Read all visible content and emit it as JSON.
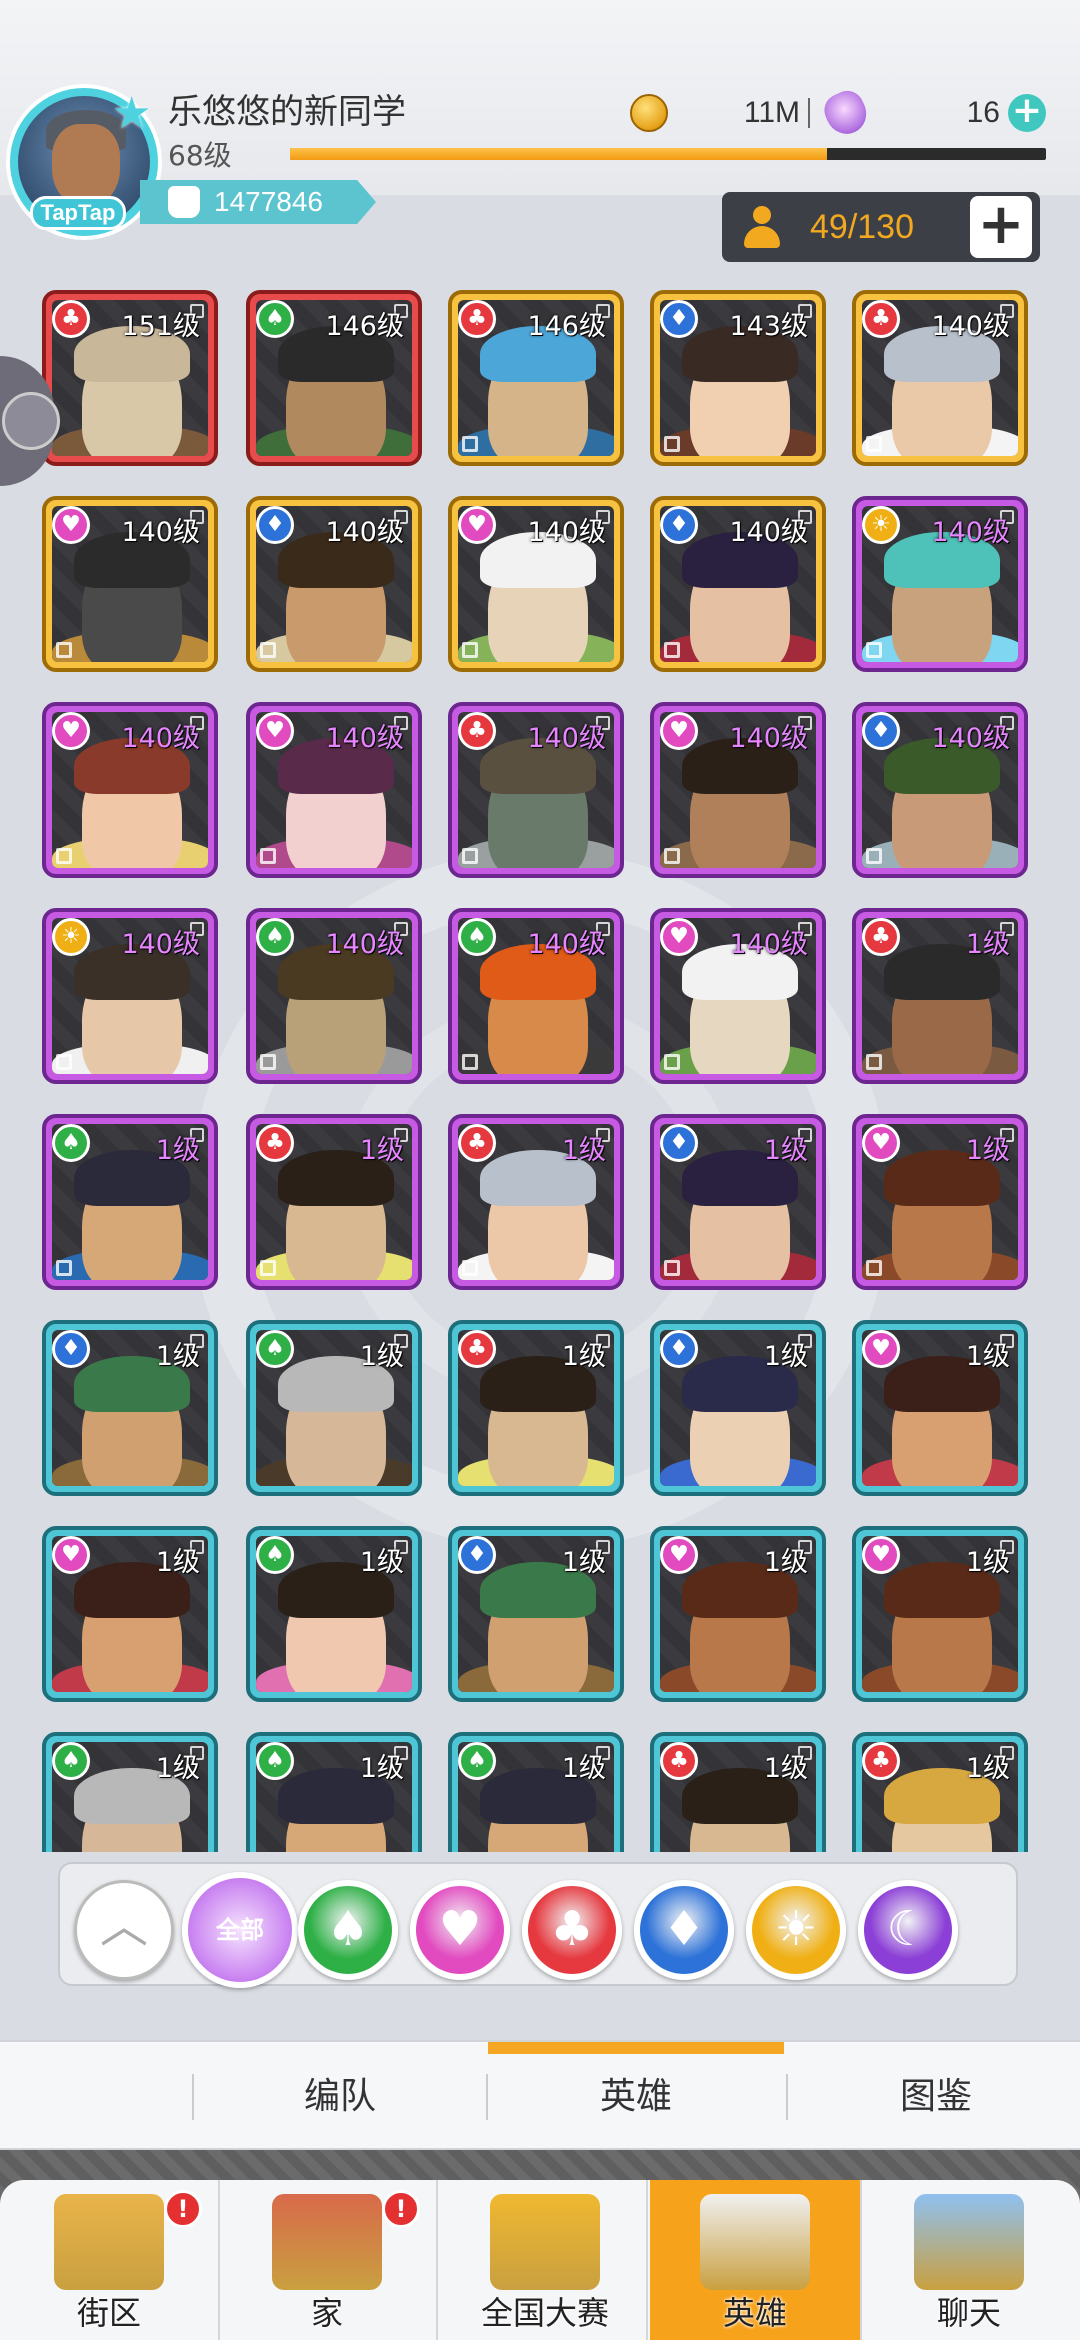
{
  "player": {
    "name": "乐悠悠的新同学",
    "level": "68级",
    "power": "1477846",
    "avatar_badge": "TapTap",
    "exp_progress": 0.71
  },
  "currency": {
    "coins": "11M",
    "gems": "16",
    "coin_icon": "gold-coin-icon",
    "gem_icon": "crystal-icon"
  },
  "capacity": {
    "text": "49/130",
    "add_label": "+"
  },
  "heroes": [
    {
      "level": "151级",
      "rarity": "red",
      "faction": "club",
      "colors": [
        "#d9c8a8",
        "#c9b79a",
        "#7a5a3a"
      ]
    },
    {
      "level": "146级",
      "rarity": "red",
      "faction": "spade",
      "colors": [
        "#b08a5e",
        "#2a2a2a",
        "#3f6e3a"
      ]
    },
    {
      "level": "146级",
      "rarity": "gold",
      "faction": "club",
      "colors": [
        "#d6b48a",
        "#4da6d8",
        "#2e6ea0"
      ]
    },
    {
      "level": "143级",
      "rarity": "gold",
      "faction": "diamond",
      "colors": [
        "#f1cfb1",
        "#3a2a24",
        "#6b3b2a"
      ]
    },
    {
      "level": "140级",
      "rarity": "gold",
      "faction": "club",
      "colors": [
        "#e9c9a8",
        "#b8c0cc",
        "#f4f4f4"
      ]
    },
    {
      "level": "140级",
      "rarity": "gold",
      "faction": "heart",
      "colors": [
        "#4a4a4a",
        "#2b2b2b",
        "#b88a3a"
      ]
    },
    {
      "level": "140级",
      "rarity": "gold",
      "faction": "diamond",
      "colors": [
        "#c99a6c",
        "#3a2a1a",
        "#d6c9a0"
      ]
    },
    {
      "level": "140级",
      "rarity": "gold",
      "faction": "heart",
      "colors": [
        "#e6d3b8",
        "#f2f2f2",
        "#86b35a"
      ]
    },
    {
      "level": "140级",
      "rarity": "gold",
      "faction": "diamond",
      "colors": [
        "#e5c0a2",
        "#2a2040",
        "#a32a3a"
      ]
    },
    {
      "level": "140级",
      "rarity": "purple",
      "faction": "sun",
      "colors": [
        "#c8a27c",
        "#4ec2b8",
        "#7ed6f0"
      ]
    },
    {
      "level": "140级",
      "rarity": "purple",
      "faction": "heart",
      "colors": [
        "#f0c8a8",
        "#8a3a2a",
        "#e8d070"
      ]
    },
    {
      "level": "140级",
      "rarity": "purple",
      "faction": "heart",
      "colors": [
        "#f3d0d0",
        "#5a2a4a",
        "#b04a8a"
      ]
    },
    {
      "level": "140级",
      "rarity": "purple",
      "faction": "club",
      "colors": [
        "#6a7a6a",
        "#5a5040",
        "#9aa0a0"
      ]
    },
    {
      "level": "140级",
      "rarity": "purple",
      "faction": "heart",
      "colors": [
        "#b0805a",
        "#2a2018",
        "#8a6a4a"
      ]
    },
    {
      "level": "140级",
      "rarity": "purple",
      "faction": "diamond",
      "colors": [
        "#c89a78",
        "#3a5a2a",
        "#9ab0b8"
      ]
    },
    {
      "level": "140级",
      "rarity": "purple",
      "faction": "sun",
      "colors": [
        "#e6c8a8",
        "#3a3028",
        "#f0f0f0"
      ]
    },
    {
      "level": "140级",
      "rarity": "purple",
      "faction": "spade",
      "colors": [
        "#b8a078",
        "#4a3a22",
        "#9a9a9a"
      ]
    },
    {
      "level": "140级",
      "rarity": "purple",
      "faction": "spade",
      "colors": [
        "#d88a4a",
        "#e05a18",
        "#3a3a3a"
      ]
    },
    {
      "level": "140级",
      "rarity": "purple",
      "faction": "heart",
      "colors": [
        "#e6d8c0",
        "#f2f2f2",
        "#6aa04a"
      ]
    },
    {
      "level": "1级",
      "rarity": "purple",
      "faction": "club",
      "colors": [
        "#9a6a48",
        "#2a2a2a",
        "#7a5a40"
      ]
    },
    {
      "level": "1级",
      "rarity": "purple",
      "faction": "spade",
      "colors": [
        "#d6a878",
        "#2a2a3a",
        "#2a6ab0"
      ]
    },
    {
      "level": "1级",
      "rarity": "purple",
      "faction": "club",
      "colors": [
        "#d8b890",
        "#2a2018",
        "#e6e070"
      ]
    },
    {
      "level": "1级",
      "rarity": "purple",
      "faction": "club",
      "colors": [
        "#ecc8a8",
        "#b8c0cc",
        "#f4f4f4"
      ]
    },
    {
      "level": "1级",
      "rarity": "purple",
      "faction": "diamond",
      "colors": [
        "#e5c0a2",
        "#2a2040",
        "#a32a3a"
      ]
    },
    {
      "level": "1级",
      "rarity": "purple",
      "faction": "heart",
      "colors": [
        "#b8784a",
        "#5a2a18",
        "#8a4a2a"
      ]
    },
    {
      "level": "1级",
      "rarity": "teal",
      "faction": "diamond",
      "colors": [
        "#d0a070",
        "#3a7a4a",
        "#8a6a3a"
      ]
    },
    {
      "level": "1级",
      "rarity": "teal",
      "faction": "spade",
      "colors": [
        "#d6b898",
        "#b8b8b8",
        "#4a3a2a"
      ]
    },
    {
      "level": "1级",
      "rarity": "teal",
      "faction": "club",
      "colors": [
        "#d8b890",
        "#2a2018",
        "#e6e070"
      ]
    },
    {
      "level": "1级",
      "rarity": "teal",
      "faction": "diamond",
      "colors": [
        "#ecd0b4",
        "#2a2a4a",
        "#3a6ad0"
      ]
    },
    {
      "level": "1级",
      "rarity": "teal",
      "faction": "heart",
      "colors": [
        "#d8a070",
        "#3a2018",
        "#c03a4a"
      ]
    },
    {
      "level": "1级",
      "rarity": "teal",
      "faction": "heart",
      "colors": [
        "#d8a070",
        "#3a2018",
        "#c03a4a"
      ]
    },
    {
      "level": "1级",
      "rarity": "teal",
      "faction": "spade",
      "colors": [
        "#f0c8b0",
        "#2a2018",
        "#e070b0"
      ]
    },
    {
      "level": "1级",
      "rarity": "teal",
      "faction": "diamond",
      "colors": [
        "#d0a070",
        "#3a7a4a",
        "#8a6a3a"
      ]
    },
    {
      "level": "1级",
      "rarity": "teal",
      "faction": "heart",
      "colors": [
        "#b8784a",
        "#5a2a18",
        "#8a4a2a"
      ]
    },
    {
      "level": "1级",
      "rarity": "teal",
      "faction": "heart",
      "colors": [
        "#b8784a",
        "#5a2a18",
        "#8a4a2a"
      ]
    },
    {
      "level": "1级",
      "rarity": "teal",
      "faction": "spade",
      "colors": [
        "#d6b898",
        "#b8b8b8",
        "#4a3a2a"
      ]
    },
    {
      "level": "1级",
      "rarity": "teal",
      "faction": "spade",
      "colors": [
        "#d6a878",
        "#2a2a3a",
        "#2a6ab0"
      ]
    },
    {
      "level": "1级",
      "rarity": "teal",
      "faction": "spade",
      "colors": [
        "#d6a878",
        "#2a2a3a",
        "#2a6ab0"
      ]
    },
    {
      "level": "1级",
      "rarity": "teal",
      "faction": "club",
      "colors": [
        "#d8b890",
        "#2a2018",
        "#e6e070"
      ]
    },
    {
      "level": "1级",
      "rarity": "teal",
      "faction": "club",
      "colors": [
        "#e6c8a0",
        "#d8a840",
        "#c03a3a"
      ]
    }
  ],
  "faction_icons": {
    "spade": "♠",
    "heart": "♥",
    "club": "♣",
    "diamond": "♦",
    "sun": "☀",
    "moon": "☾"
  },
  "filters": [
    {
      "name": "collapse",
      "icon": "︿"
    },
    {
      "name": "all",
      "icon": "全部"
    },
    {
      "name": "spade",
      "icon": "♠",
      "color": "#2fb047"
    },
    {
      "name": "heart",
      "icon": "♥",
      "color": "#e24bc0"
    },
    {
      "name": "club",
      "icon": "♣",
      "color": "#e5393f"
    },
    {
      "name": "diamond",
      "icon": "♦",
      "color": "#2d72d8"
    },
    {
      "name": "sun",
      "icon": "☀",
      "color": "#f0b015"
    },
    {
      "name": "moon",
      "icon": "☾",
      "color": "#8b3fd6"
    }
  ],
  "subtabs": [
    "编队",
    "英雄",
    "图鉴"
  ],
  "nav": [
    {
      "label": "街区",
      "alert": "!",
      "icon": "signpost-icon"
    },
    {
      "label": "家",
      "alert": "!",
      "icon": "house-icon"
    },
    {
      "label": "全国大赛",
      "alert": "",
      "icon": "trophy-icon"
    },
    {
      "label": "英雄",
      "alert": "",
      "icon": "hero-cards-icon"
    },
    {
      "label": "聊天",
      "alert": "",
      "icon": "chat-bubble-icon"
    }
  ],
  "colors": {
    "accent": "#f5a623",
    "teal": "#4ed2e0"
  }
}
